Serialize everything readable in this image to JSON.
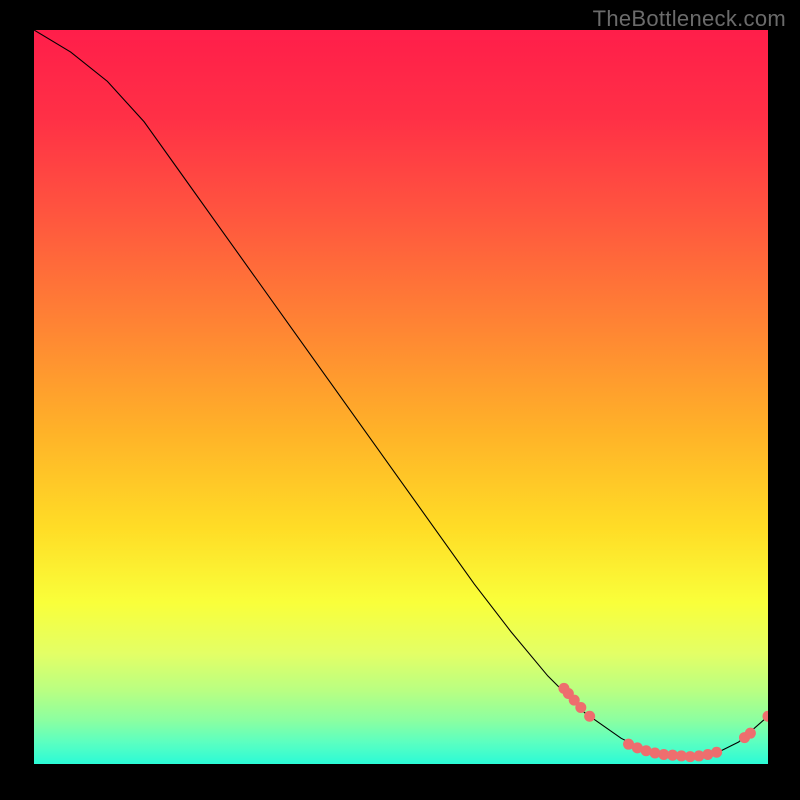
{
  "watermark": "TheBottleneck.com",
  "colors": {
    "background": "#000000",
    "curve_stroke": "#000000",
    "point_fill": "#ee6e6e",
    "gradient_stops": [
      {
        "offset": 0.0,
        "color": "#ff1e4a"
      },
      {
        "offset": 0.12,
        "color": "#ff3046"
      },
      {
        "offset": 0.25,
        "color": "#ff553f"
      },
      {
        "offset": 0.4,
        "color": "#ff8334"
      },
      {
        "offset": 0.55,
        "color": "#ffb328"
      },
      {
        "offset": 0.68,
        "color": "#ffdd26"
      },
      {
        "offset": 0.78,
        "color": "#f9ff3a"
      },
      {
        "offset": 0.85,
        "color": "#e3ff66"
      },
      {
        "offset": 0.9,
        "color": "#b9ff82"
      },
      {
        "offset": 0.94,
        "color": "#8cffa0"
      },
      {
        "offset": 0.97,
        "color": "#5cffc0"
      },
      {
        "offset": 1.0,
        "color": "#2bfbd6"
      }
    ]
  },
  "chart_data": {
    "type": "line",
    "xlabel": "",
    "ylabel": "",
    "xlim": [
      0,
      100
    ],
    "ylim": [
      0,
      100
    ],
    "series": [
      {
        "name": "bottleneck-curve",
        "x": [
          0,
          5,
          10,
          15,
          20,
          25,
          30,
          35,
          40,
          45,
          50,
          55,
          60,
          65,
          70,
          75,
          80,
          83,
          86,
          90,
          93,
          96,
          100
        ],
        "y": [
          100,
          97,
          93,
          87.5,
          80.5,
          73.5,
          66.5,
          59.5,
          52.5,
          45.5,
          38.5,
          31.5,
          24.5,
          18.0,
          12.0,
          7.0,
          3.5,
          2.0,
          1.3,
          1.0,
          1.5,
          3.0,
          6.5
        ]
      }
    ],
    "points": [
      {
        "name": "cluster-left-1",
        "x": 72.2,
        "y": 10.3
      },
      {
        "name": "cluster-left-2",
        "x": 72.8,
        "y": 9.6
      },
      {
        "name": "cluster-left-3",
        "x": 73.6,
        "y": 8.7
      },
      {
        "name": "cluster-left-4",
        "x": 74.5,
        "y": 7.7
      },
      {
        "name": "cluster-left-5",
        "x": 75.7,
        "y": 6.5
      },
      {
        "name": "flat-1",
        "x": 81.0,
        "y": 2.7
      },
      {
        "name": "flat-2",
        "x": 82.2,
        "y": 2.2
      },
      {
        "name": "flat-3",
        "x": 83.4,
        "y": 1.8
      },
      {
        "name": "flat-4",
        "x": 84.6,
        "y": 1.5
      },
      {
        "name": "flat-5",
        "x": 85.8,
        "y": 1.3
      },
      {
        "name": "flat-6",
        "x": 87.0,
        "y": 1.2
      },
      {
        "name": "flat-7",
        "x": 88.2,
        "y": 1.1
      },
      {
        "name": "flat-8",
        "x": 89.4,
        "y": 1.0
      },
      {
        "name": "flat-9",
        "x": 90.6,
        "y": 1.1
      },
      {
        "name": "flat-10",
        "x": 91.8,
        "y": 1.3
      },
      {
        "name": "flat-11",
        "x": 93.0,
        "y": 1.6
      },
      {
        "name": "right-1",
        "x": 96.8,
        "y": 3.6
      },
      {
        "name": "right-2",
        "x": 97.6,
        "y": 4.2
      },
      {
        "name": "right-end",
        "x": 100.0,
        "y": 6.5
      }
    ]
  }
}
